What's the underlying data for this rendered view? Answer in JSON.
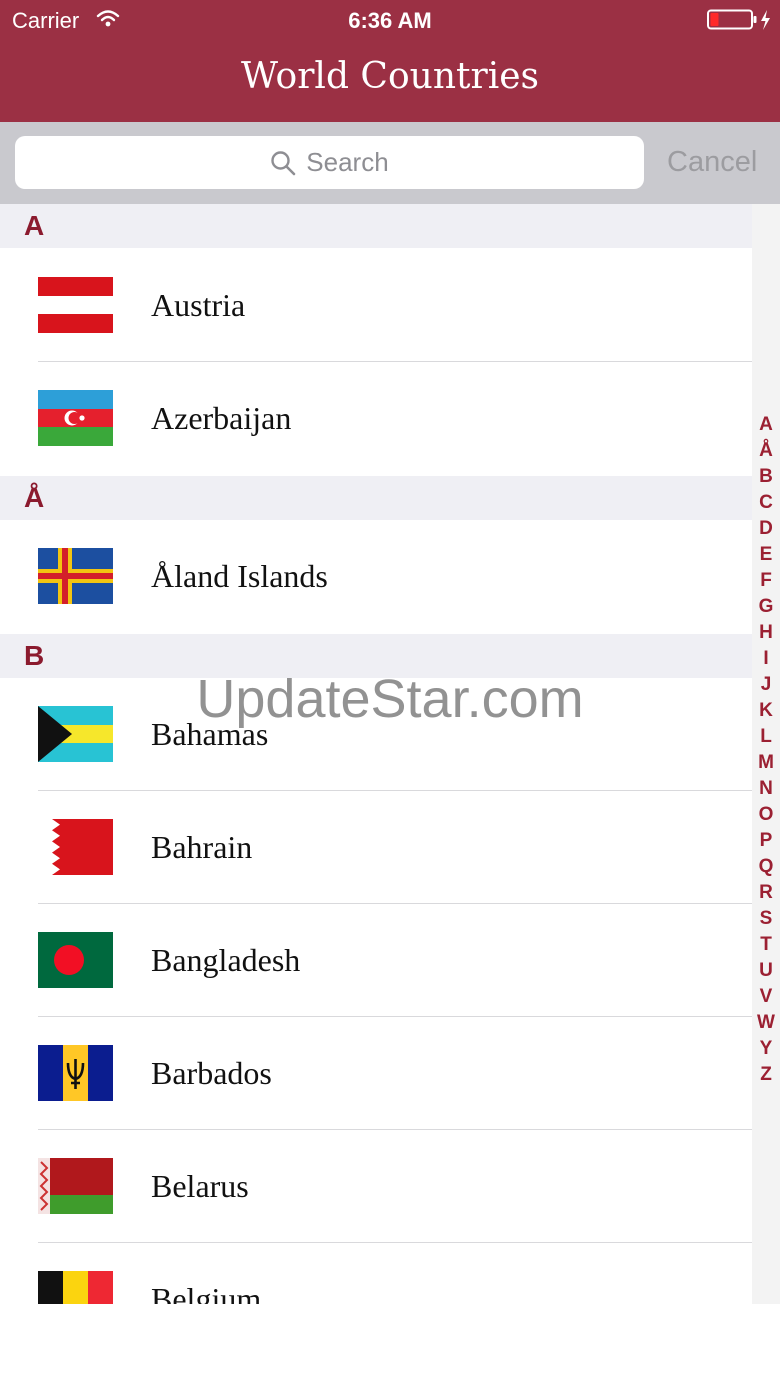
{
  "status_bar": {
    "carrier": "Carrier",
    "time": "6:36 AM"
  },
  "nav": {
    "title": "World Countries"
  },
  "search": {
    "placeholder": "Search",
    "cancel_label": "Cancel"
  },
  "sections": [
    {
      "letter": "A",
      "countries": [
        {
          "name": "Austria",
          "flag": "flag-austria"
        },
        {
          "name": "Azerbaijan",
          "flag": "flag-azerbaijan"
        }
      ]
    },
    {
      "letter": "Å",
      "countries": [
        {
          "name": "Åland Islands",
          "flag": "flag-aland"
        }
      ]
    },
    {
      "letter": "B",
      "countries": [
        {
          "name": "Bahamas",
          "flag": "flag-bahamas"
        },
        {
          "name": "Bahrain",
          "flag": "flag-bahrain"
        },
        {
          "name": "Bangladesh",
          "flag": "flag-bangladesh"
        },
        {
          "name": "Barbados",
          "flag": "flag-barbados"
        },
        {
          "name": "Belarus",
          "flag": "flag-belarus"
        },
        {
          "name": "Belgium",
          "flag": "flag-belgium"
        }
      ]
    }
  ],
  "index_letters": [
    "A",
    "Å",
    "B",
    "C",
    "D",
    "E",
    "F",
    "G",
    "H",
    "I",
    "J",
    "K",
    "L",
    "M",
    "N",
    "O",
    "P",
    "Q",
    "R",
    "S",
    "T",
    "U",
    "V",
    "W",
    "Y",
    "Z"
  ],
  "watermark": "UpdateStar.com",
  "colors": {
    "brand": "#9b3044",
    "section_letter": "#8b1a2e",
    "section_bg": "#efeff4"
  }
}
